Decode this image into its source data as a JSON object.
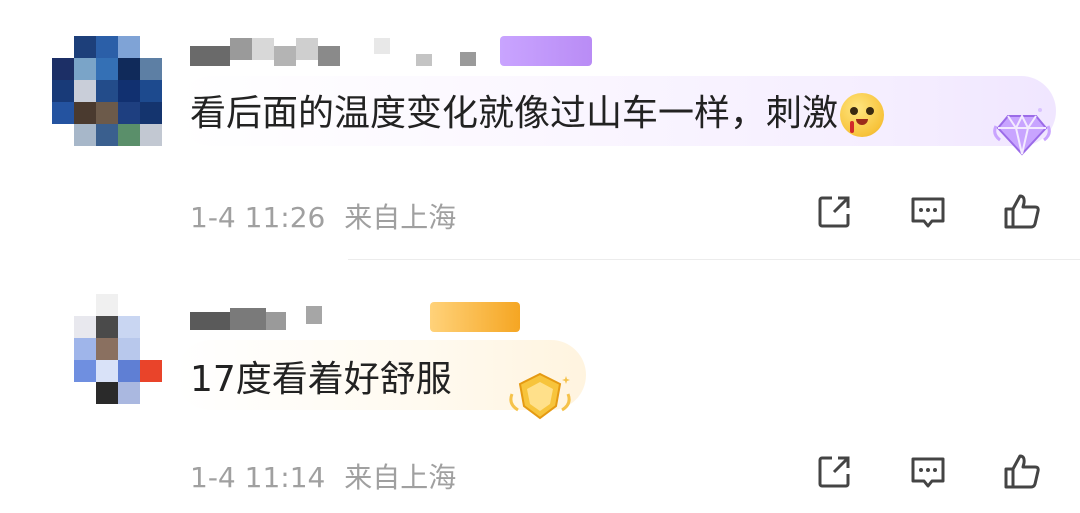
{
  "comments": [
    {
      "username": "",
      "text": "看后面的温度变化就像过山车一样，刺激",
      "emoji": "flushed-bleeding-emoji",
      "badge": "purple-diamond-badge",
      "time": "1-4 11:26",
      "location": "来自上海"
    },
    {
      "username": "",
      "text": "17度看着好舒服",
      "emoji": "",
      "badge": "gold-shield-badge",
      "time": "1-4 11:14",
      "location": "来自上海"
    }
  ],
  "icons": {
    "share": "share-icon",
    "reply": "comment-icon",
    "like": "thumbs-up-icon"
  },
  "colors": {
    "text": "#222222",
    "meta": "#a0a0a0",
    "icon": "#444444",
    "vip_purple": "#b98cf5",
    "vip_gold": "#f5a623"
  }
}
